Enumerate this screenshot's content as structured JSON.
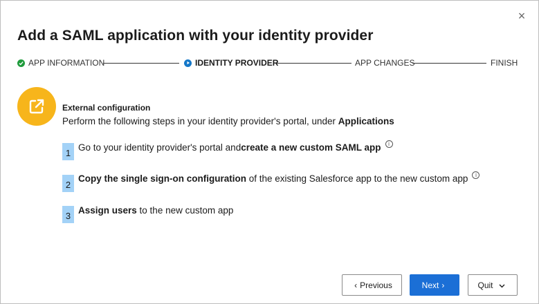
{
  "dialog": {
    "title": "Add a SAML application with your identity provider",
    "close_glyph": "×"
  },
  "stepper": {
    "steps": [
      {
        "label": "APP INFORMATION",
        "state": "done"
      },
      {
        "label": "IDENTITY PROVIDER",
        "state": "current"
      },
      {
        "label": "APP CHANGES",
        "state": "pending"
      },
      {
        "label": "FINISH",
        "state": "pending"
      }
    ]
  },
  "external": {
    "icon": "external-link-icon",
    "icon_color": "#f7b51b",
    "heading": "External configuration",
    "description_prefix": "Perform the following steps in your identity provider's portal, under ",
    "description_bold": "Applications"
  },
  "instructions": [
    {
      "number": "1",
      "prefix": "Go to your identity provider's portal and ",
      "bold": "create a new custom SAML app",
      "suffix": "",
      "info": true
    },
    {
      "number": "2",
      "prefix": "",
      "bold": "Copy the single sign-on configuration",
      "suffix": " of the existing Salesforce app to the new custom app",
      "info": true
    },
    {
      "number": "3",
      "prefix": "",
      "bold": "Assign users",
      "suffix": " to the new custom app",
      "info": false
    }
  ],
  "buttons": {
    "previous": "Previous",
    "next": "Next",
    "quit": "Quit"
  },
  "colors": {
    "primary": "#1b6fd6",
    "step_done": "#1f9b3c",
    "step_current": "#1477c8",
    "number_badge": "#a3d2f7"
  }
}
